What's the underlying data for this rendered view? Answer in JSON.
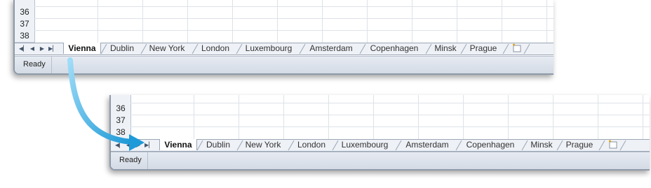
{
  "workbook": {
    "rows": [
      "36",
      "37",
      "38"
    ],
    "sheets": [
      "Vienna",
      "Dublin",
      "New York",
      "London",
      "Luxembourg",
      "Amsterdam",
      "Copenhagen",
      "Minsk",
      "Prague"
    ],
    "active_sheet": "Vienna",
    "status_text": "Ready",
    "nav_icons": [
      "first-sheet-icon",
      "prev-sheet-icon",
      "next-sheet-icon",
      "last-sheet-icon"
    ],
    "new_sheet_icon": "insert-worksheet-icon"
  },
  "colors": {
    "arrow": "#3fb0e8",
    "tabbar": "#eef1f6",
    "status_bar": "#d8dfe8"
  }
}
